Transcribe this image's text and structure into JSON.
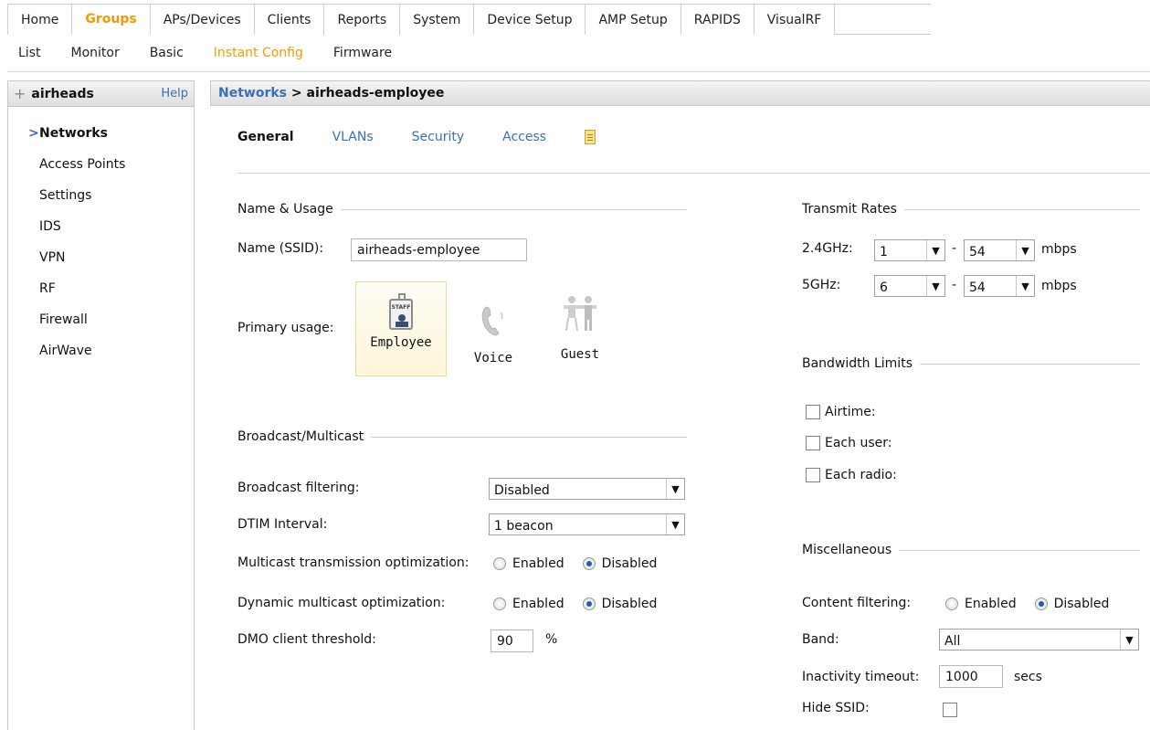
{
  "top_nav": [
    "Home",
    "Groups",
    "APs/Devices",
    "Clients",
    "Reports",
    "System",
    "Device Setup",
    "AMP Setup",
    "RAPIDS",
    "VisualRF"
  ],
  "top_nav_active": "Groups",
  "sub_nav": [
    "List",
    "Monitor",
    "Basic",
    "Instant Config",
    "Firmware"
  ],
  "sub_nav_active": "Instant Config",
  "sidebar": {
    "group_name": "airheads",
    "help": "Help",
    "items": [
      "Networks",
      "Access Points",
      "Settings",
      "IDS",
      "VPN",
      "RF",
      "Firewall",
      "AirWave"
    ]
  },
  "breadcrumb": {
    "link": "Networks",
    "sep": " > ",
    "current": "airheads-employee"
  },
  "tabs": [
    "General",
    "VLANs",
    "Security",
    "Access"
  ],
  "name_usage": {
    "section": "Name & Usage",
    "ssid_label": "Name (SSID):",
    "ssid_value": "airheads-employee",
    "usage_label": "Primary usage:",
    "options": [
      "Employee",
      "Voice",
      "Guest"
    ],
    "badge_text": "STAFF"
  },
  "broadcast": {
    "section": "Broadcast/Multicast",
    "filtering_label": "Broadcast filtering:",
    "filtering_value": "Disabled",
    "dtim_label": "DTIM Interval:",
    "dtim_value": "1 beacon",
    "mto_label": "Multicast transmission optimization:",
    "dmo_label": "Dynamic multicast optimization:",
    "enabled": "Enabled",
    "disabled": "Disabled",
    "threshold_label": "DMO client threshold:",
    "threshold_value": "90",
    "threshold_unit": "%"
  },
  "transmit": {
    "section": "Transmit Rates",
    "g24_label": "2.4GHz:",
    "g24_min": "1",
    "g24_max": "54",
    "g5_label": "5GHz:",
    "g5_min": "6",
    "g5_max": "54",
    "dash": "-",
    "unit": "mbps"
  },
  "bandwidth": {
    "section": "Bandwidth Limits",
    "items": [
      "Airtime:",
      "Each user:",
      "Each radio:"
    ]
  },
  "misc": {
    "section": "Miscellaneous",
    "content_label": "Content filtering:",
    "enabled": "Enabled",
    "disabled": "Disabled",
    "band_label": "Band:",
    "band_value": "All",
    "inactivity_label": "Inactivity timeout:",
    "inactivity_value": "1000",
    "inactivity_unit": "secs",
    "hide_label": "Hide SSID:"
  },
  "colors": {
    "accent": "#f29a00",
    "link": "#3a6fb6",
    "radio_on": "#1d5fb5"
  }
}
